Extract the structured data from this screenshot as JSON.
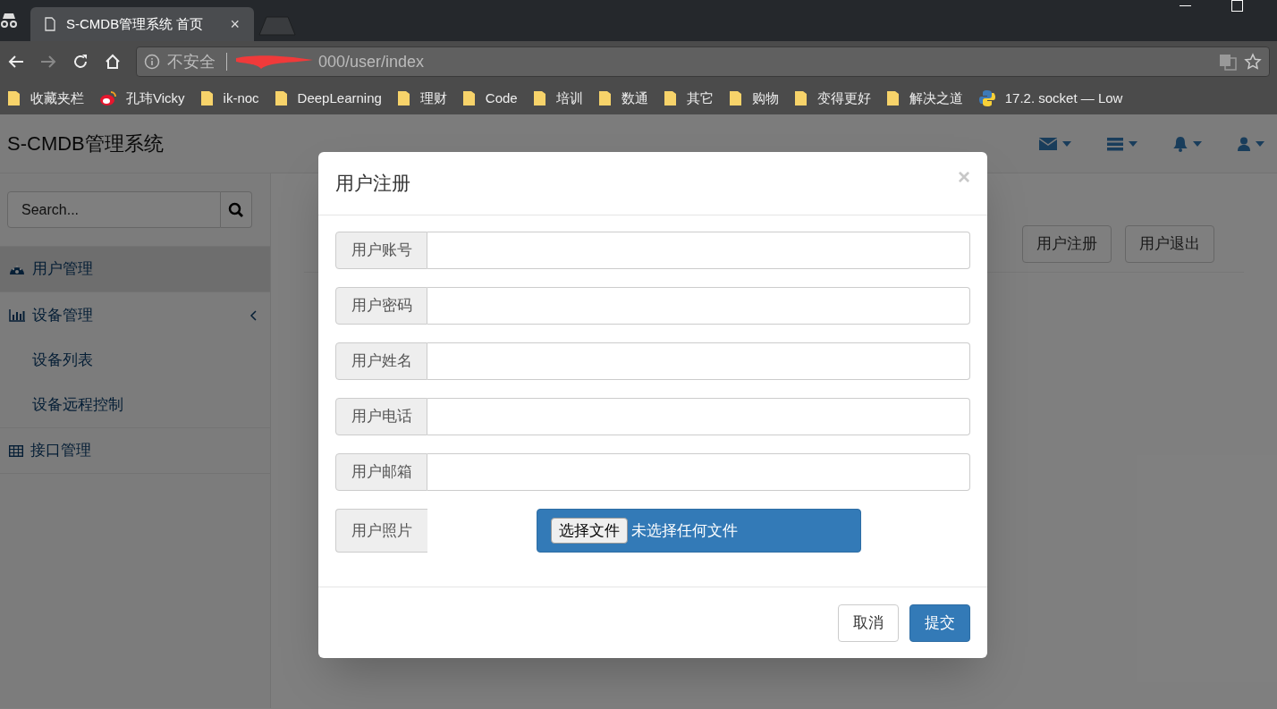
{
  "browser": {
    "tab_title": "S-CMDB管理系统 首页",
    "tab_close": "×",
    "security": "不安全",
    "url": "000/user/index",
    "bookmarks": [
      {
        "label": "收藏夹栏",
        "kind": "folder"
      },
      {
        "label": "孔玮Vicky",
        "kind": "weibo"
      },
      {
        "label": "ik-noc",
        "kind": "folder"
      },
      {
        "label": "DeepLearning",
        "kind": "folder"
      },
      {
        "label": "理财",
        "kind": "folder"
      },
      {
        "label": "Code",
        "kind": "folder"
      },
      {
        "label": "培训",
        "kind": "folder"
      },
      {
        "label": "数通",
        "kind": "folder"
      },
      {
        "label": "其它",
        "kind": "folder"
      },
      {
        "label": "购物",
        "kind": "folder"
      },
      {
        "label": "变得更好",
        "kind": "folder"
      },
      {
        "label": "解决之道",
        "kind": "folder"
      },
      {
        "label": "17.2. socket — Low",
        "kind": "python"
      }
    ]
  },
  "app": {
    "brand": "S-CMDB管理系统",
    "search": {
      "placeholder": "Search..."
    },
    "sidebar": {
      "items": [
        {
          "label": "用户管理",
          "selected": true
        },
        {
          "label": "设备管理",
          "selected": false,
          "expanded": true,
          "children": [
            {
              "label": "设备列表",
              "selected": false
            },
            {
              "label": "设备远程控制",
              "selected": false
            }
          ]
        },
        {
          "label": "接口管理",
          "selected": false
        }
      ]
    },
    "buttons": [
      "用户注册",
      "用户退出"
    ]
  },
  "modal": {
    "title": "用户注册",
    "close": "×",
    "fields": [
      {
        "label": "用户账号",
        "kind": "text"
      },
      {
        "label": "用户密码",
        "kind": "text"
      },
      {
        "label": "用户姓名",
        "kind": "text"
      },
      {
        "label": "用户电话",
        "kind": "text"
      },
      {
        "label": "用户邮箱",
        "kind": "text"
      },
      {
        "label": "用户照片",
        "kind": "file",
        "button": "选择文件",
        "status": "未选择任何文件"
      }
    ],
    "buttons": [
      {
        "label": "取消",
        "kind": "default"
      },
      {
        "label": "提交",
        "kind": "primary"
      }
    ]
  }
}
